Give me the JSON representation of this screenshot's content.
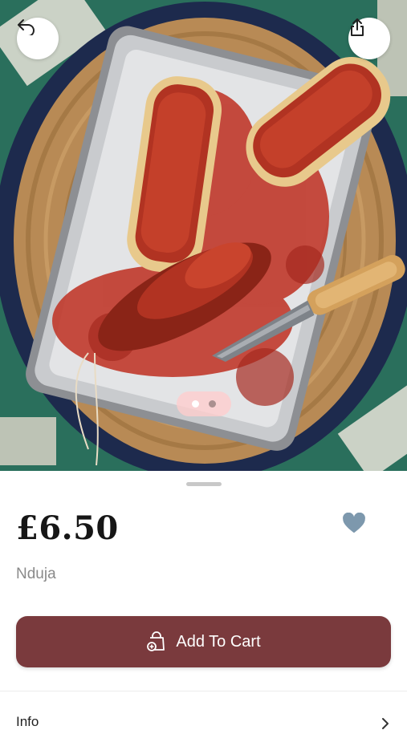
{
  "product": {
    "price": "£6.50",
    "name": "Nduja"
  },
  "actions": {
    "add_to_cart_label": "Add To Cart",
    "back_icon": "back-arrow-icon",
    "share_icon": "share-icon",
    "favorite_icon": "heart-icon",
    "favorite_color": "#7d98ad"
  },
  "gallery": {
    "image_count": 2,
    "current_index": 1
  },
  "info_section": {
    "label": "Info"
  },
  "colors": {
    "primary": "#7a3a3d",
    "background": "#ffffff",
    "price_text": "#161616",
    "subtitle_text": "#8a8a8a"
  }
}
